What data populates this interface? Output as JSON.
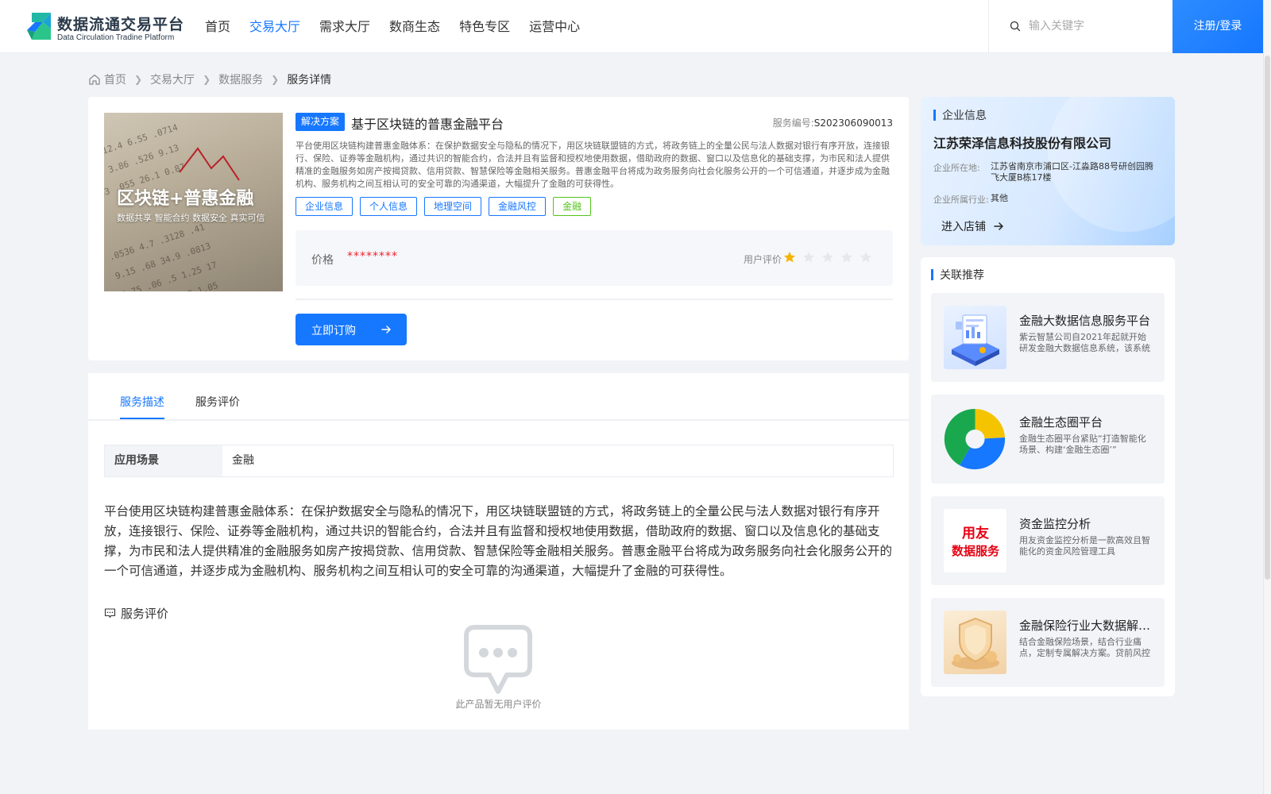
{
  "header": {
    "logo_title": "数据流通交易平台",
    "logo_subtitle": "Data Circulation Tradine Platform",
    "nav": [
      "首页",
      "交易大厅",
      "需求大厅",
      "数商生态",
      "特色专区",
      "运营中心"
    ],
    "active_nav": "交易大厅",
    "search_placeholder": "输入关键字",
    "login_label": "注册/登录",
    "accent": "#1677ff"
  },
  "breadcrumb": [
    "首页",
    "交易大厅",
    "数据服务",
    "服务详情"
  ],
  "product": {
    "image_title": "区块链+普惠金融",
    "image_subtitle": "数据共享  智能合约  数据安全  真实可信",
    "badge": "解决方案",
    "title": "基于区块链的普惠金融平台",
    "service_no_label": "服务编号:",
    "service_no": "S202306090013",
    "description": "平台使用区块链构建普惠金融体系：在保护数据安全与隐私的情况下，用区块链联盟链的方式，将政务链上的全量公民与法人数据对银行有序开放，连接银行、保险、证券等金融机构，通过共识的智能合约，合法并且有监督和授权地使用数据，借助政府的数据、窗口以及信息化的基础支撑，为市民和法人提供精准的金融服务如房产按揭贷款、信用贷款、智慧保险等金融相关服务。普惠金融平台将成为政务服务向社会化服务公开的一个可信通道，并逐步成为金融机构、服务机构之间互相认可的安全可靠的沟通渠道，大幅提升了金融的可获得性。",
    "tags": [
      "企业信息",
      "个人信息",
      "地理空间",
      "金融风控",
      "金融"
    ],
    "price_label": "价格",
    "price_value": "********",
    "rating_label": "用户评价",
    "rating": 1,
    "rating_max": 5,
    "order_label": "立即订购"
  },
  "detail": {
    "tabs": [
      "服务描述",
      "服务评价"
    ],
    "active_tab": "服务描述",
    "scene_key": "应用场景",
    "scene_value": "金融",
    "full_description": "平台使用区块链构建普惠金融体系：在保护数据安全与隐私的情况下，用区块链联盟链的方式，将政务链上的全量公民与法人数据对银行有序开放，连接银行、保险、证券等金融机构，通过共识的智能合约，合法并且有监督和授权地使用数据，借助政府的数据、窗口以及信息化的基础支撑，为市民和法人提供精准的金融服务如房产按揭贷款、信用贷款、智慧保险等金融相关服务。普惠金融平台将成为政务服务向社会化服务公开的一个可信通道，并逐步成为金融机构、服务机构之间互相认可的安全可靠的沟通渠道，大幅提升了金融的可获得性。",
    "review_heading": "服务评价",
    "empty_review_text": "此产品暂无用户评价"
  },
  "company": {
    "section_label": "企业信息",
    "name": "江苏荣泽信息科技股份有限公司",
    "location_label": "企业所在地:",
    "location": "江苏省南京市浦口区-江淼路88号研创园腾飞大厦B栋17楼",
    "industry_label": "企业所属行业:",
    "industry": "其他",
    "enter_shop": "进入店铺"
  },
  "recommend": {
    "section_label": "关联推荐",
    "items": [
      {
        "title": "金融大数据信息服务平台",
        "desc": "紫云智慧公司自2021年起就开始研发金融大数据信息系统，该系统",
        "thumb_text": ""
      },
      {
        "title": "金融生态圈平台",
        "desc": "金融生态圈平台紧贴“打造智能化场景、构建‘金融生态圈’”",
        "thumb_text": ""
      },
      {
        "title": "资金监控分析",
        "desc": "用友资金监控分析是一款高效且智能化的资金风险管理工具",
        "thumb_text": "用友\n数据服务"
      },
      {
        "title": "金融保险行业大数据解决方案",
        "desc": "结合金融保险场景，结合行业痛点，定制专属解决方案。贷前风控",
        "thumb_text": ""
      }
    ]
  }
}
